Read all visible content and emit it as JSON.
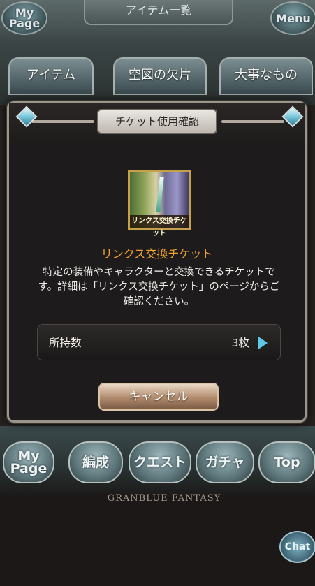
{
  "header": {
    "title": "アイテム一覧",
    "mypage_label": "My Page",
    "menu_label": "Menu"
  },
  "tabs": [
    {
      "label": "アイテム"
    },
    {
      "label": "空図の欠片"
    },
    {
      "label": "大事なもの"
    }
  ],
  "modal": {
    "title": "チケット使用確認",
    "item_image_label": "リンクス交換チケット",
    "item_name": "リンクス交換チケット",
    "description": "特定の装備やキャラクターと交換できるチケットです。詳細は「リンクス交換チケット」のページからご確認ください。",
    "owned_label": "所持数",
    "owned_value": "3枚",
    "cancel_label": "キャンセル"
  },
  "bottom_nav": {
    "mypage": "My Page",
    "enhance": "編成",
    "quest": "クエスト",
    "gacha": "ガチャ",
    "top": "Top"
  },
  "brand": "GRANBLUE FANTASY",
  "chat_label": "Chat",
  "colors": {
    "item_name": "#f0a235",
    "arrow": "#5fc7e6"
  }
}
